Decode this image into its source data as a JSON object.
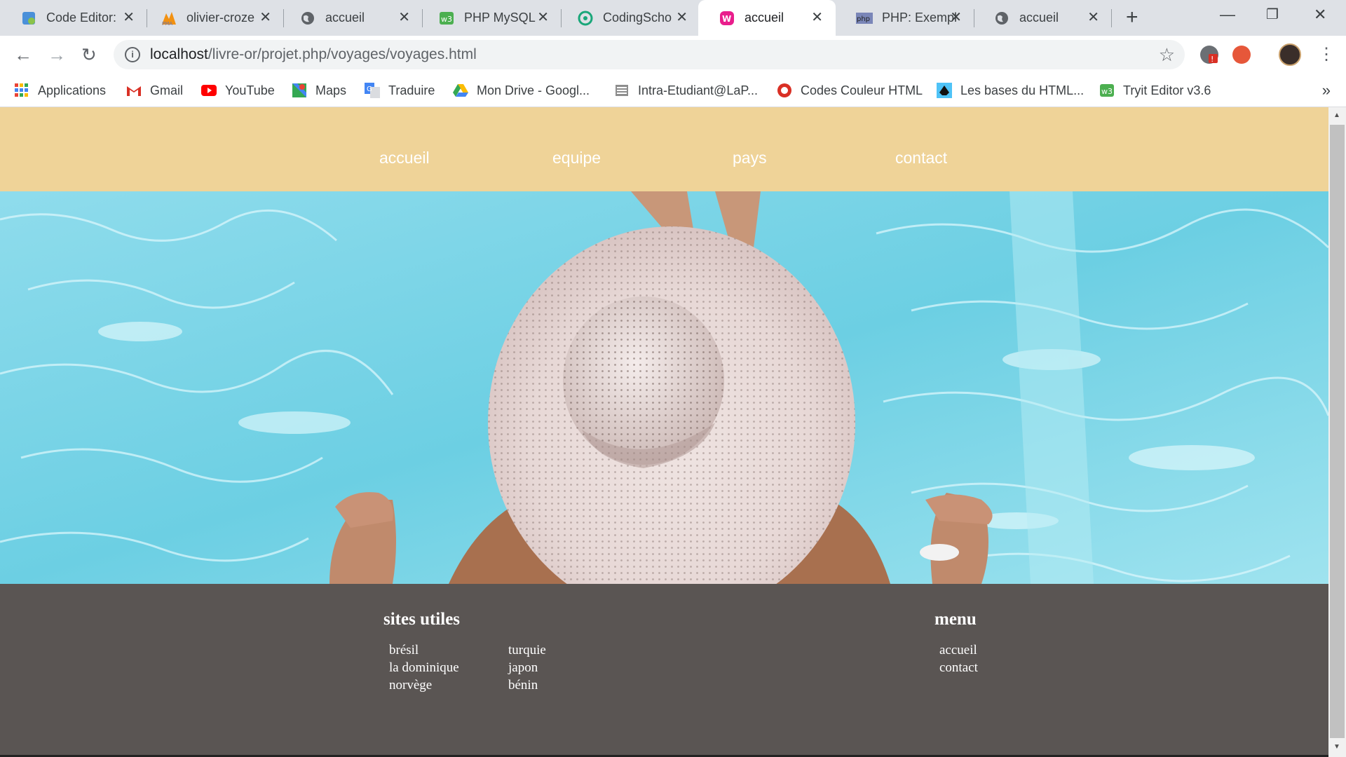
{
  "browser": {
    "tabs": [
      {
        "title": "Code Editor:",
        "icon": "code-editor-icon",
        "color": "#4a90d9"
      },
      {
        "title": "olivier-croze",
        "icon": "phpmyadmin-icon",
        "color": "#f29111"
      },
      {
        "title": "accueil",
        "icon": "globe-icon",
        "color": "#5f6368"
      },
      {
        "title": "PHP MySQL",
        "icon": "w3schools-icon",
        "color": "#4caf50"
      },
      {
        "title": "CodingScho",
        "icon": "codingschool-icon",
        "color": "#1aa77a"
      },
      {
        "title": "accueil",
        "icon": "w-logo-icon",
        "color": "#e91e8c",
        "active": true
      },
      {
        "title": "PHP: Exempl",
        "icon": "php-icon",
        "color": "#7a86b8"
      },
      {
        "title": "accueil",
        "icon": "globe-icon",
        "color": "#5f6368"
      }
    ],
    "address": {
      "host": "localhost",
      "path": "/livre-or/projet.php/voyages/voyages.html"
    },
    "bookmarks": [
      {
        "label": "Applications",
        "icon": "apps-grid-icon"
      },
      {
        "label": "Gmail",
        "icon": "gmail-icon"
      },
      {
        "label": "YouTube",
        "icon": "youtube-icon"
      },
      {
        "label": "Maps",
        "icon": "maps-icon"
      },
      {
        "label": "Traduire",
        "icon": "translate-icon"
      },
      {
        "label": "Mon Drive - Googl...",
        "icon": "drive-icon"
      },
      {
        "label": "Intra-Etudiant@LaP...",
        "icon": "intranet-icon"
      },
      {
        "label": "Codes Couleur HTML",
        "icon": "color-codes-icon"
      },
      {
        "label": "Les bases du HTML...",
        "icon": "html-basics-icon"
      },
      {
        "label": "Tryit Editor v3.6",
        "icon": "w3schools-icon"
      }
    ],
    "more_bookmarks": "»"
  },
  "site": {
    "nav": [
      "accueil",
      "equipe",
      "pays",
      "contact"
    ],
    "footer": {
      "sites_title": "sites utiles",
      "sites_col1": [
        "brésil",
        "la dominique",
        "norvège"
      ],
      "sites_col2": [
        "turquie",
        "japon",
        "bénin"
      ],
      "menu_title": "menu",
      "menu_links": [
        "accueil",
        "contact"
      ]
    },
    "colors": {
      "nav_bg": "#efd398",
      "footer_bg": "#5a5553",
      "water": "#7fd4e6"
    }
  }
}
